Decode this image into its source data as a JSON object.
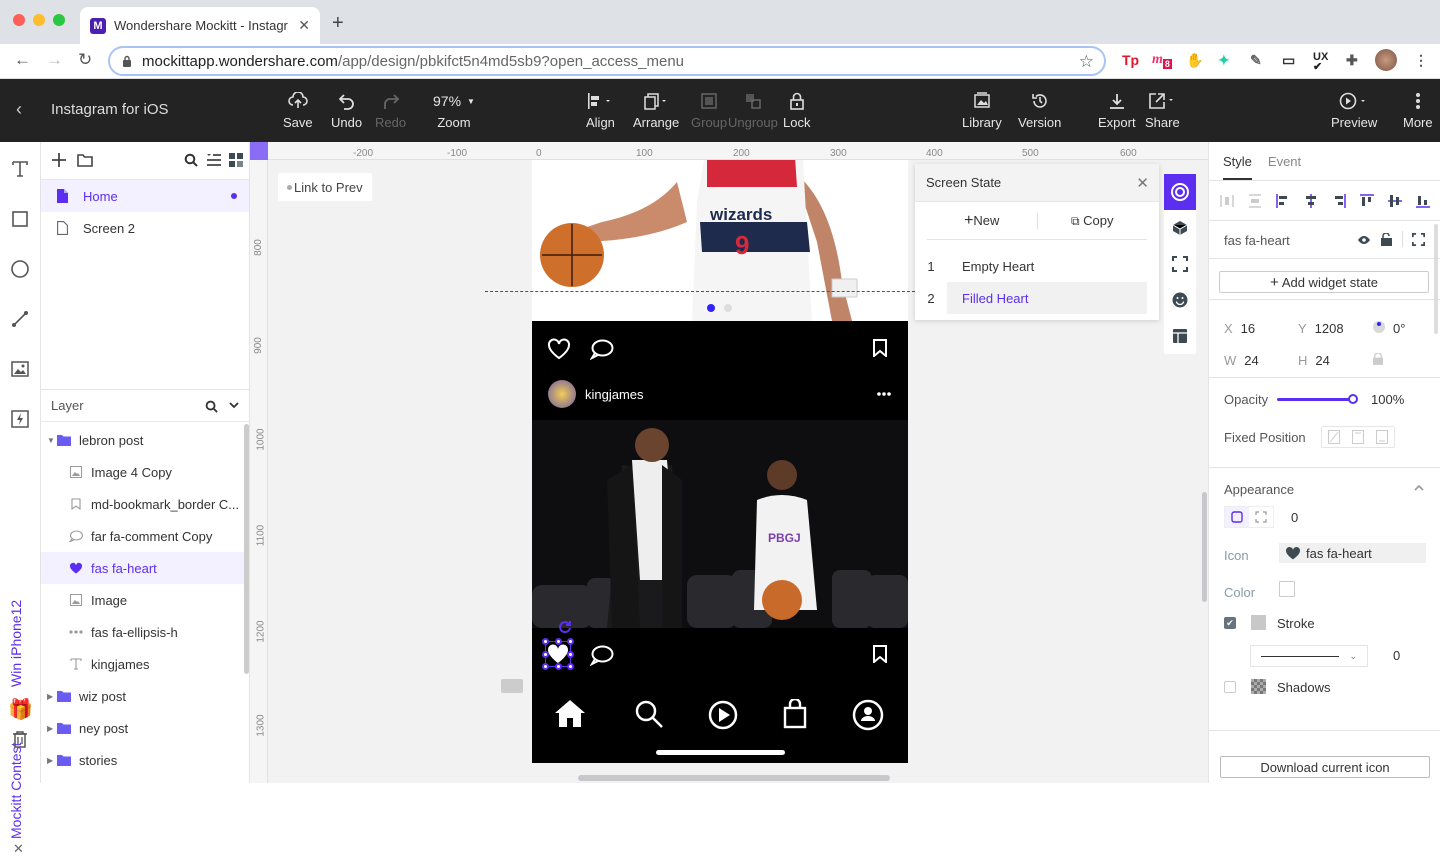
{
  "browser": {
    "tab_title": "Wondershare Mockitt - Instagr",
    "tab_favicon": "M",
    "url_host": "mockittapp.wondershare.com",
    "url_path": "/app/design/pbkifct5n4md5sb9?open_access_menu",
    "extensions": [
      "Tp",
      "m",
      "glove",
      "figure",
      "eyedropper",
      "screenshot",
      "UX",
      "puzzle",
      "avatar"
    ],
    "ext_badge": "8"
  },
  "toolbar": {
    "project_title": "Instagram for iOS",
    "save": "Save",
    "undo": "Undo",
    "redo": "Redo",
    "zoom_value": "97%",
    "zoom": "Zoom",
    "align": "Align",
    "arrange": "Arrange",
    "group": "Group",
    "ungroup": "Ungroup",
    "lock": "Lock",
    "library": "Library",
    "version": "Version",
    "export": "Export",
    "share": "Share",
    "preview": "Preview",
    "more": "More"
  },
  "rail": {
    "contest_text": "Mockitt Contest",
    "contest_text2": "Win iPhone12"
  },
  "pages": {
    "items": [
      {
        "label": "Home",
        "selected": true
      },
      {
        "label": "Screen 2",
        "selected": false
      }
    ]
  },
  "layers": {
    "title": "Layer",
    "items": [
      {
        "label": "lebron post",
        "type": "folder",
        "expanded": true
      },
      {
        "label": "Image 4 Copy",
        "type": "image"
      },
      {
        "label": "md-bookmark_border C...",
        "type": "bookmark"
      },
      {
        "label": "far fa-comment Copy",
        "type": "comment"
      },
      {
        "label": "fas fa-heart",
        "type": "heart",
        "selected": true
      },
      {
        "label": "Image",
        "type": "image"
      },
      {
        "label": "fas fa-ellipsis-h",
        "type": "ellipsis"
      },
      {
        "label": "kingjames",
        "type": "text"
      },
      {
        "label": "wiz post",
        "type": "folder"
      },
      {
        "label": "ney post",
        "type": "folder"
      },
      {
        "label": "stories",
        "type": "folder"
      }
    ]
  },
  "canvas": {
    "link_to_prev": "Link to Prev",
    "hruler_labels": [
      "-200",
      "-100",
      "0",
      "100",
      "200",
      "300",
      "400",
      "500",
      "600"
    ],
    "vruler_labels": [
      "800",
      "900",
      "1000",
      "1100",
      "1200",
      "1300"
    ],
    "post_username": "kingjames",
    "jersey_text": "wizards",
    "jersey_number": "9",
    "hoodie_text": "PBGJ"
  },
  "screen_state": {
    "title": "Screen State",
    "new_label": "New",
    "copy_label": "Copy",
    "states": [
      {
        "num": "1",
        "label": "Empty Heart",
        "selected": false
      },
      {
        "num": "2",
        "label": "Filled Heart",
        "selected": true
      }
    ]
  },
  "inspector": {
    "tab_style": "Style",
    "tab_event": "Event",
    "widget_name": "fas fa-heart",
    "add_state": "Add widget state",
    "x_label": "X",
    "x": "16",
    "y_label": "Y",
    "y": "1208",
    "rotation": "0°",
    "w_label": "W",
    "w": "24",
    "h_label": "H",
    "h": "24",
    "opacity_label": "Opacity",
    "opacity": "100",
    "opacity_unit": "%",
    "opacity_fraction": 1.0,
    "fixed_position": "Fixed Position",
    "appearance": "Appearance",
    "radius": "0",
    "icon_label": "Icon",
    "icon_value": "fas fa-heart",
    "color_label": "Color",
    "color_value": "#ffffff",
    "stroke_label": "Stroke",
    "stroke_checked": true,
    "stroke_width": "0",
    "shadows_label": "Shadows",
    "shadows_checked": false,
    "download": "Download current icon"
  },
  "colors": {
    "accent": "#5b2ef0",
    "toolbar_bg": "#232323"
  }
}
